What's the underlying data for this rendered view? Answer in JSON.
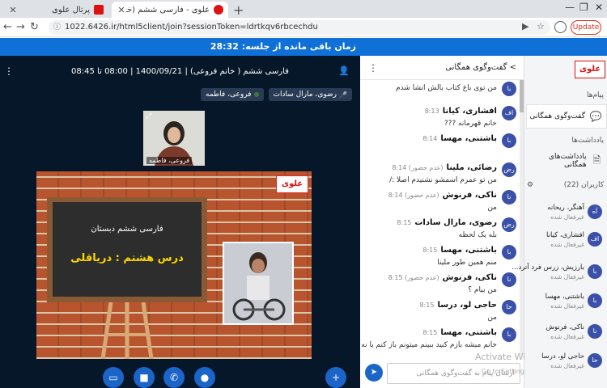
{
  "browser": {
    "tabs": [
      {
        "title": "پرتال علوی",
        "active": false
      },
      {
        "title": "علوی - فارسی ششم (خانم فر",
        "active": true
      }
    ],
    "url": "1022.6426.ir/html5client/join?sessionToken=ldrtkqv6rbcechdu",
    "update_label": "Update"
  },
  "session": {
    "timer_text": "زمان باقی مانده از جلسه: 28:32"
  },
  "main": {
    "title": "فارسی ششم ( خانم فروعی) | 1400/09/21 | 08:00 تا 08:45",
    "presenters": [
      "رضوی، مارال سادات",
      "فروعی، فاطمه"
    ],
    "webcam_name": "فروعی، فاطمه",
    "slide": {
      "logo": "علوی",
      "line1": "فارسی ششم دبستان",
      "line2": "درس هشتم : دریاقلی"
    },
    "controls": [
      "screen-share",
      "video",
      "phone",
      "microphone",
      "add"
    ]
  },
  "chat": {
    "title": "گفت‌وگوی همگانی",
    "input_placeholder": "ارسال پیام به گفت‌وگوی همگانی",
    "messages": [
      {
        "avatar": "با",
        "name": "",
        "time": "",
        "text": "من توی باغ کتاب بالش انشا شدم"
      },
      {
        "avatar": "اف",
        "name": "افشاری، کیانا",
        "time": "8:13",
        "text": "خانم قهرمانه ???"
      },
      {
        "avatar": "با",
        "name": "باشتنی، مهسا",
        "time": "8:14",
        "text": ""
      },
      {
        "avatar": "رض",
        "name": "رضائی، ملینا",
        "time": "(عدم حضور) 8:14",
        "text": "من تو عمرم اسمشو نشنیدم اصلا :/"
      },
      {
        "avatar": "نا",
        "name": "ناکی، فرنوش",
        "time": "(عدم حضور) 8:14",
        "text": "من"
      },
      {
        "avatar": "رض",
        "name": "رضوی، مارال سادات",
        "time": "8:15",
        "text": "بله یک لحظه"
      },
      {
        "avatar": "با",
        "name": "باشتنی، مهسا",
        "time": "8:15",
        "text": "منم همین طور ملینا"
      },
      {
        "avatar": "نا",
        "name": "ناکی، فرنوش",
        "time": "(عدم حضور) 8:15",
        "text": "من بیام ؟"
      },
      {
        "avatar": "حا",
        "name": "حاجی لو، درسا",
        "time": "8:15",
        "text": "من"
      },
      {
        "avatar": "با",
        "name": "باشتنی، مهسا",
        "time": "8:15",
        "text": "خانم میشه بازم کنید ببینم میتونم باز کنم یا نه"
      }
    ],
    "activate_line1": "Activate Windows",
    "activate_line2": "Go to Settings to activate Windows."
  },
  "sidebar": {
    "logo": "علوی",
    "section_messages": "پیام‌ها",
    "public_chat": "گفت‌وگوی همگانی",
    "section_notes": "یادداشت‌ها",
    "shared_notes": "یادداشت‌های همگانی",
    "users_label": "کاربران (22)",
    "users": [
      {
        "avatar": "آه",
        "name": "آهنگر، ریحانه",
        "status": "غیرفعال شده"
      },
      {
        "avatar": "اف",
        "name": "افشاری، کیانا",
        "status": "غیرفعال شده"
      },
      {
        "avatar": "با",
        "name": "بارزیش، زرس فرد آترد...",
        "status": "غیرفعال شده"
      },
      {
        "avatar": "با",
        "name": "باشتنی، مهسا",
        "status": "غیرفعال شده"
      },
      {
        "avatar": "نا",
        "name": "ناکی، فرنوش",
        "status": "غیرفعال شده"
      },
      {
        "avatar": "حا",
        "name": "حاجی لو، درسا",
        "status": "غیرفعال شده"
      }
    ]
  }
}
